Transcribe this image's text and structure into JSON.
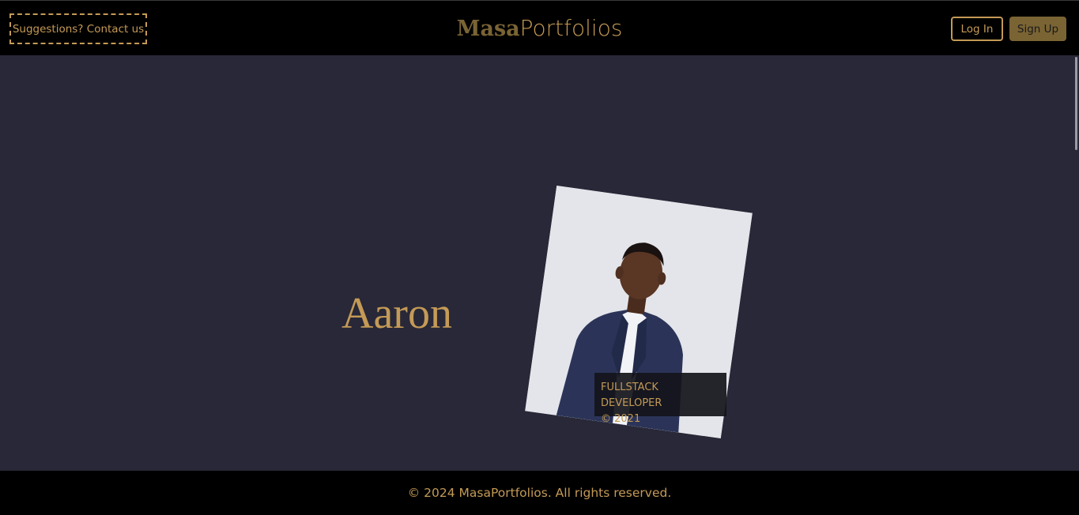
{
  "header": {
    "contact_label": "Suggestions? Contact us",
    "brand_part1": "Masa",
    "brand_part2": "Portfolios",
    "login_label": "Log In",
    "signup_label": "Sign Up"
  },
  "profile": {
    "name": "Aaron",
    "role": "FULLSTACK DEVELOPER",
    "year": "© 2021"
  },
  "footer": {
    "copyright": "© 2024 MasaPortfolios. All rights reserved."
  },
  "colors": {
    "accent": "#c49a56",
    "accent_dark": "#7a6434",
    "background": "#282838",
    "bar": "#000000"
  }
}
